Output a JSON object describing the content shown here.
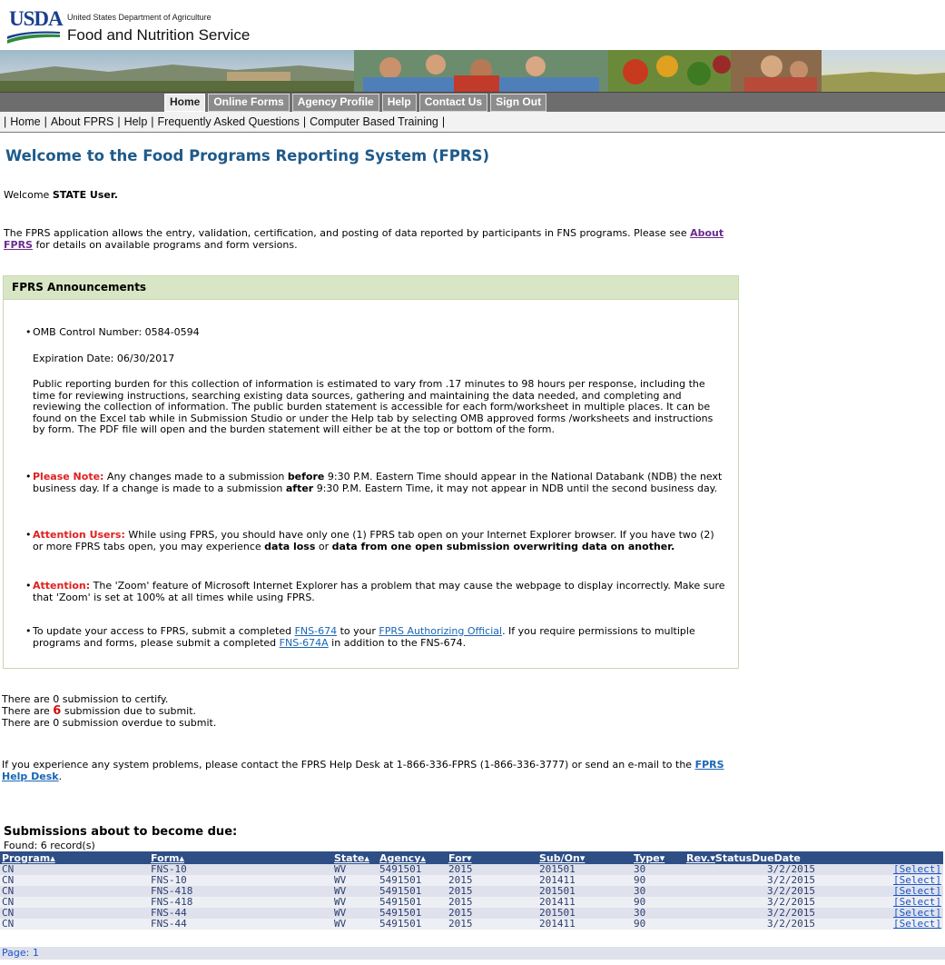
{
  "header": {
    "usda": "USDA",
    "department": "United States Department of Agriculture",
    "agency": "Food and Nutrition Service"
  },
  "nav": {
    "tabs": [
      "Home",
      "Online Forms",
      "Agency Profile",
      "Help",
      "Contact Us",
      "Sign Out"
    ],
    "active": "Home"
  },
  "subnav": [
    "Home",
    "About FPRS",
    "Help",
    "Frequently Asked Questions",
    "Computer Based Training"
  ],
  "page_title": "Welcome to the Food Programs Reporting System (FPRS)",
  "welcome": {
    "prefix": "Welcome ",
    "user": "STATE User."
  },
  "intro": {
    "text1": "The FPRS application allows the entry, validation, certification, and posting of data reported by participants in FNS programs. Please see ",
    "link": "About FPRS",
    "text2": " for details on available programs and form versions."
  },
  "announcements": {
    "title": "FPRS Announcements",
    "omb": "OMB Control Number: 0584-0594",
    "expiration": "Expiration Date: 06/30/2017",
    "burden": "Public reporting burden for this collection of information is estimated to vary from .17 minutes to 98 hours per response, including the time for reviewing instructions, searching existing data sources, gathering and maintaining the data needed, and completing and reviewing the collection of information. The public burden statement is accessible for each form/worksheet in multiple places. It can be found on the Excel tab while in Submission Studio or under the Help tab by selecting OMB approved forms /worksheets and instructions by form. The PDF file will open and the burden statement will either be at the top or bottom of the form.",
    "note_label": "Please Note:",
    "note_a": " Any changes made to a submission ",
    "note_b1": "before",
    "note_c": " 9:30 P.M. Eastern Time should appear in the National Databank (NDB) the next business day. If a change is made to a submission ",
    "note_b2": "after",
    "note_d": " 9:30 P.M. Eastern Time, it may not appear in NDB until the second business day.",
    "users_label": "Attention Users:",
    "users_a": " While using FPRS, you should have only one (1) FPRS tab open on your Internet Explorer browser. If you have two (2) or more FPRS tabs open, you may experience ",
    "users_b1": "data loss",
    "users_c": " or ",
    "users_b2": "data from one open submission overwriting data on another.",
    "zoom_label": "Attention:",
    "zoom_text": " The 'Zoom' feature of Microsoft Internet Explorer has a problem that may cause the webpage to display incorrectly. Make sure that 'Zoom' is set at 100% at all times while using FPRS.",
    "access_a": "To update your access to FPRS, submit a completed ",
    "access_link1": "FNS-674",
    "access_b": " to your ",
    "access_link2": "FPRS Authorizing Official",
    "access_c": ". If you require permissions to multiple programs and forms, please submit a completed ",
    "access_link3": "FNS-674A",
    "access_d": " in addition to the FNS-674."
  },
  "counts": {
    "l1": "There are 0 submission to certify.",
    "l2a": "There are ",
    "l2num": "6",
    "l2b": " submission due to submit.",
    "l3": "There are 0 submission overdue to submit."
  },
  "helpdesk": {
    "text": "If you experience any system problems, please contact the FPRS Help Desk at 1-866-336-FPRS (1-866-336-3777) or send an e-mail to the ",
    "link": "FPRS Help Desk",
    "end": "."
  },
  "submissions": {
    "title": "Submissions about to become due:",
    "found": "Found: 6 record(s)",
    "headers": [
      "Program▴",
      "Form▴",
      "State▴",
      "Agency▴",
      "For▾",
      "Sub/On▾",
      "Type▾",
      "Rev.▾",
      "StatusDueDate"
    ],
    "rows": [
      [
        "CN",
        "FNS-10",
        "WV",
        "5491501",
        "2015",
        "201501",
        "30",
        "3/2/2015",
        "[Select]"
      ],
      [
        "CN",
        "FNS-10",
        "WV",
        "5491501",
        "2015",
        "201411",
        "90",
        "3/2/2015",
        "[Select]"
      ],
      [
        "CN",
        "FNS-418",
        "WV",
        "5491501",
        "2015",
        "201501",
        "30",
        "3/2/2015",
        "[Select]"
      ],
      [
        "CN",
        "FNS-418",
        "WV",
        "5491501",
        "2015",
        "201411",
        "90",
        "3/2/2015",
        "[Select]"
      ],
      [
        "CN",
        "FNS-44",
        "WV",
        "5491501",
        "2015",
        "201501",
        "30",
        "3/2/2015",
        "[Select]"
      ],
      [
        "CN",
        "FNS-44",
        "WV",
        "5491501",
        "2015",
        "201411",
        "90",
        "3/2/2015",
        "[Select]"
      ]
    ],
    "page": "Page: 1"
  }
}
